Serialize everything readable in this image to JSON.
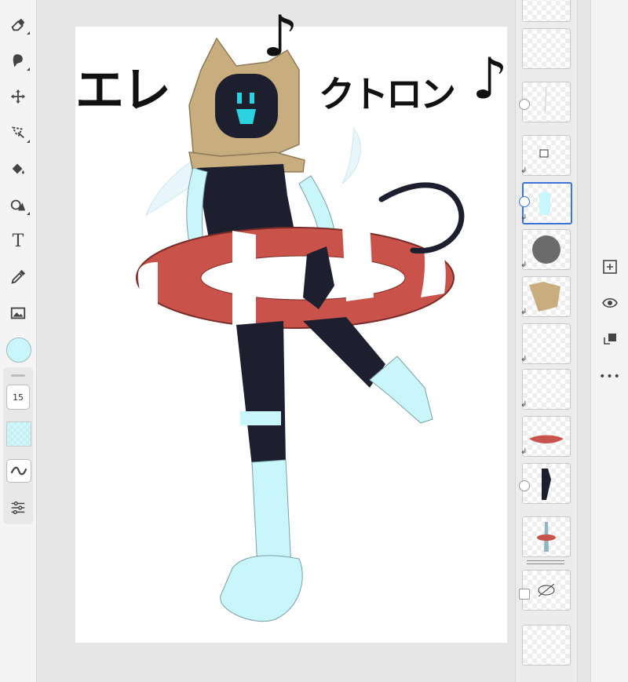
{
  "app": {
    "accent": "#3b73d6",
    "canvas_bg": "#ffffff"
  },
  "left_toolbar": {
    "tools": [
      {
        "name": "eraser-tool",
        "icon": "eraser-icon"
      },
      {
        "name": "smudge-tool",
        "icon": "smudge-icon"
      },
      {
        "name": "move-tool",
        "icon": "move-icon"
      },
      {
        "name": "lasso-tool",
        "icon": "lasso-icon"
      },
      {
        "name": "fill-tool",
        "icon": "bucket-icon"
      },
      {
        "name": "shape-tool",
        "icon": "shape-icon"
      },
      {
        "name": "text-tool",
        "icon": "text-icon"
      },
      {
        "name": "eyedropper-tool",
        "icon": "eyedropper-icon"
      },
      {
        "name": "image-tool",
        "icon": "image-icon"
      }
    ],
    "text_tool_glyph": "T",
    "current_color": "#c8f6fa",
    "brush_size": "15",
    "stroke_glyph": "~"
  },
  "canvas": {
    "handwritten_title_line1": "エレ",
    "handwritten_title_line2": "クトロン",
    "music_note": "♪"
  },
  "layers": {
    "items": [
      {
        "name": "layer-1",
        "selected": false
      },
      {
        "name": "layer-2",
        "selected": false
      },
      {
        "name": "layer-3",
        "selected": false
      },
      {
        "name": "layer-4",
        "selected": false
      },
      {
        "name": "layer-5",
        "selected": true
      },
      {
        "name": "layer-6",
        "selected": false
      },
      {
        "name": "layer-7",
        "selected": false
      },
      {
        "name": "layer-8",
        "selected": false
      },
      {
        "name": "layer-9",
        "selected": false
      },
      {
        "name": "layer-10",
        "selected": false
      },
      {
        "name": "layer-11",
        "selected": false
      },
      {
        "name": "layer-12",
        "selected": false
      },
      {
        "name": "layer-13",
        "selected": false
      },
      {
        "name": "layer-14",
        "selected": false
      }
    ]
  },
  "right_col": {
    "buttons": [
      {
        "name": "add-layer-button",
        "icon": "plus-box-icon"
      },
      {
        "name": "visibility-button",
        "icon": "eye-icon"
      },
      {
        "name": "layer-options-button",
        "icon": "layer-arrange-icon"
      },
      {
        "name": "more-button",
        "icon": "ellipsis-icon"
      }
    ],
    "more_glyph": "•••"
  }
}
